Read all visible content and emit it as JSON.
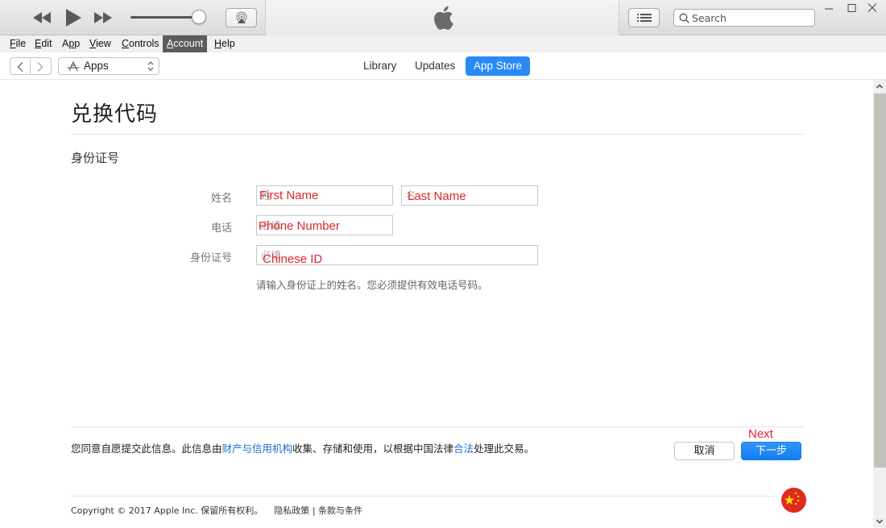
{
  "player": {
    "rewind_icon": "rewind-icon",
    "play_icon": "play-icon",
    "fast_forward_icon": "fast-forward-icon",
    "volume_level": 0.92,
    "airplay_icon": "airplay-icon",
    "apple_logo": "apple-logo-icon",
    "list_icon": "list-icon",
    "search": {
      "placeholder": "Search",
      "value": ""
    }
  },
  "menu": {
    "items": [
      {
        "label": "File",
        "accel": "F",
        "rest": "ile"
      },
      {
        "label": "Edit",
        "accel": "E",
        "rest": "dit"
      },
      {
        "label": "App",
        "pre": "A",
        "accel": "p",
        "rest": "p"
      },
      {
        "label": "View",
        "accel": "V",
        "rest": "iew"
      },
      {
        "label": "Controls",
        "accel": "C",
        "rest": "ontrols"
      },
      {
        "label": "Account",
        "accel": "A",
        "rest": "ccount",
        "active": true
      },
      {
        "label": "Help",
        "accel": "H",
        "rest": "elp"
      }
    ]
  },
  "nav": {
    "media_kind": "Apps",
    "tabs": [
      {
        "label": "Library"
      },
      {
        "label": "Updates"
      },
      {
        "label": "App Store",
        "selected": true
      }
    ]
  },
  "page": {
    "title": "兑换代码",
    "section_title": "身份证号",
    "fields": {
      "name_label": "姓名",
      "first_name_placeholder": "姓",
      "last_name_placeholder": "名",
      "phone_label": "电话",
      "phone_placeholder": "必填",
      "id_label": "身份证号",
      "id_placeholder": "必填"
    },
    "annotations": {
      "first_name": "First Name",
      "last_name": "Last Name",
      "phone": "Phone Number",
      "id": "Chinese ID",
      "next": "Next"
    },
    "hint": "请输入身份证上的姓名。您必须提供有效电话号码。",
    "consent": {
      "part1": "您同意自愿提交此信息。此信息由",
      "link1": "财产与信用机构",
      "part2": "收集、存储和使用，以根据中国法律",
      "link2": "合法",
      "part3": "处理此交易。"
    },
    "buttons": {
      "cancel": "取消",
      "next": "下一步"
    },
    "footer": {
      "copyright": "Copyright © 2017 Apple Inc. 保留所有权利。",
      "privacy": "隐私政策",
      "separator": "|",
      "terms": "条款与条件"
    },
    "region_flag": "china-flag-icon"
  },
  "colors": {
    "accent": "#2a8af5",
    "link": "#1a6fcc",
    "annotation": "#e0262a",
    "menu_active": "#5b5b5b"
  },
  "scroll": {
    "position_fraction": 0.0,
    "visible_fraction": 0.87
  }
}
